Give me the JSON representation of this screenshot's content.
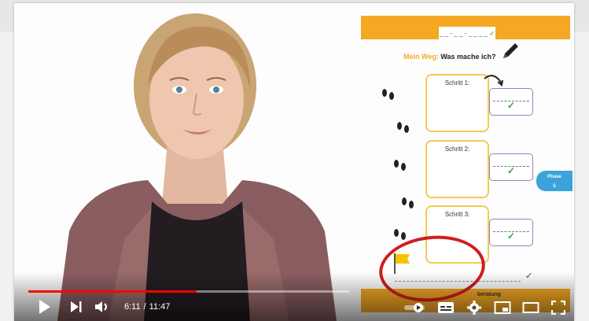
{
  "player": {
    "current_time": "6:11",
    "duration": "11:47",
    "progress": 0.525,
    "separator": "/"
  },
  "worksheet": {
    "tab_text": "_ _ - _ _ - _ _ _ _ ✓",
    "title_accent": "Mein Weg:",
    "title_rest": "Was mache ich?",
    "steps": [
      {
        "label": "Schritt 1:"
      },
      {
        "label": "Schritt 2:"
      },
      {
        "label": "Schritt 3:"
      }
    ],
    "phase_line1": "Phase",
    "phase_line2": "5",
    "footer_text": "beratung"
  },
  "colors": {
    "accent_orange": "#f5a823",
    "progress_red": "#ff0000",
    "annotation_red": "#d11d1d",
    "box_yellow": "#f2cb55",
    "box_purple": "#9b7fc2",
    "phase_blue": "#3ba3d9",
    "check_green": "#3aa53a"
  },
  "icons": {
    "play": "play-icon",
    "next": "next-icon",
    "volume": "volume-icon",
    "autoplay": "autoplay-toggle-icon",
    "captions": "captions-icon",
    "settings": "gear-icon",
    "miniplayer": "miniplayer-icon",
    "theater": "theater-mode-icon",
    "fullscreen": "fullscreen-icon"
  }
}
